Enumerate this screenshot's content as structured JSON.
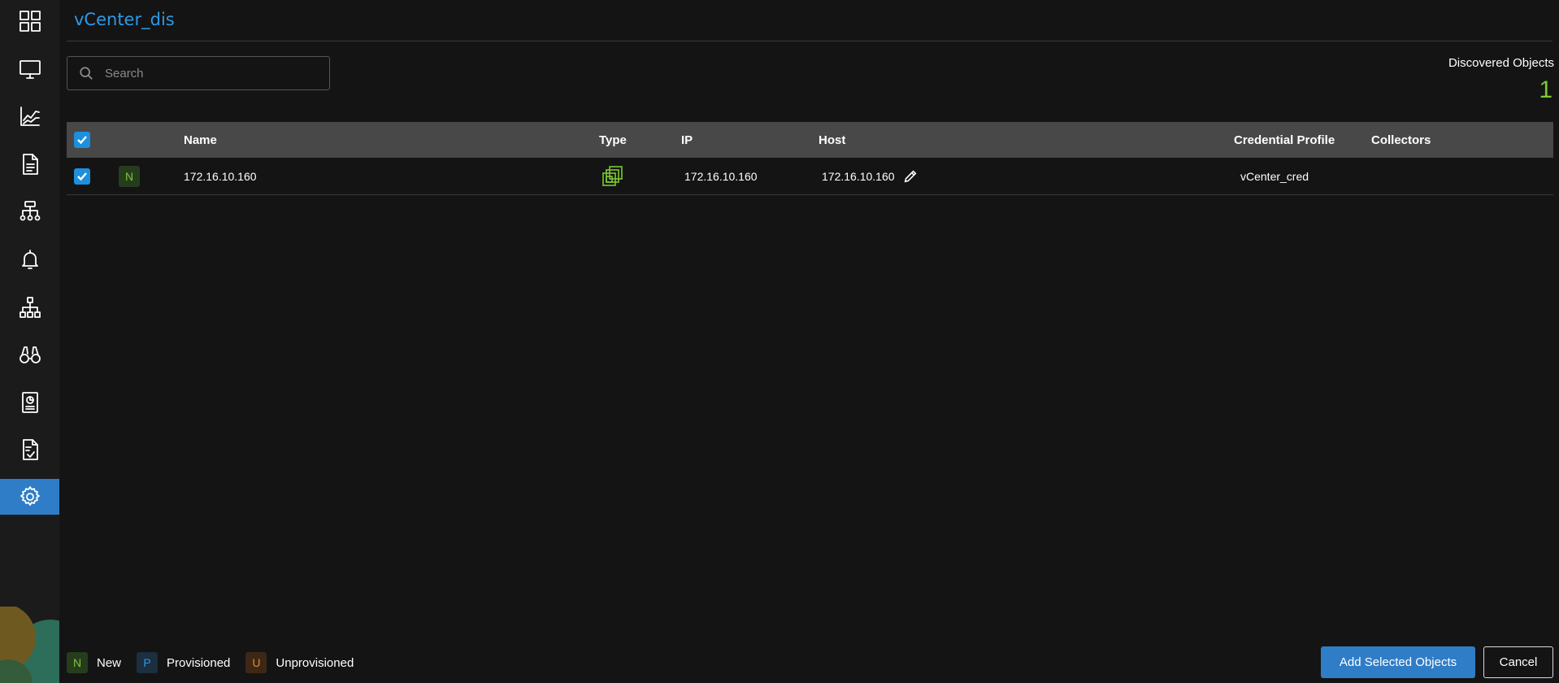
{
  "page": {
    "title": "vCenter_dis",
    "discovered_label": "Discovered Objects",
    "discovered_count": "1"
  },
  "search": {
    "placeholder": "Search",
    "value": ""
  },
  "sidebar": {
    "items": [
      {
        "icon": "grid-icon"
      },
      {
        "icon": "monitor-icon"
      },
      {
        "icon": "chart-line-icon"
      },
      {
        "icon": "document-icon"
      },
      {
        "icon": "network-topology-icon"
      },
      {
        "icon": "bell-icon"
      },
      {
        "icon": "hierarchy-icon"
      },
      {
        "icon": "binoculars-icon"
      },
      {
        "icon": "report-icon"
      },
      {
        "icon": "checklist-icon"
      },
      {
        "icon": "gear-icon",
        "active": true
      }
    ],
    "active_color": "#2f7dc7"
  },
  "table": {
    "columns": {
      "name": "Name",
      "type": "Type",
      "ip": "IP",
      "host": "Host",
      "credential_profile": "Credential Profile",
      "collectors": "Collectors"
    },
    "rows": [
      {
        "checked": true,
        "status": "N",
        "name": "172.16.10.160",
        "type_icon": "vmware-icon",
        "ip": "172.16.10.160",
        "host": "172.16.10.160",
        "credential_profile": "vCenter_cred",
        "collectors": ""
      }
    ]
  },
  "legend": [
    {
      "badge": "N",
      "label": "New",
      "color": "#7dc832",
      "bg": "#263d1d"
    },
    {
      "badge": "P",
      "label": "Provisioned",
      "color": "#2d9ae6",
      "bg": "#1b2f40"
    },
    {
      "badge": "U",
      "label": "Unprovisioned",
      "color": "#e08a2a",
      "bg": "#3d2815"
    }
  ],
  "actions": {
    "add_label": "Add Selected Objects",
    "cancel_label": "Cancel"
  },
  "colors": {
    "accent": "#2f7dc7",
    "title": "#2d9ae6",
    "success": "#7dc832"
  }
}
